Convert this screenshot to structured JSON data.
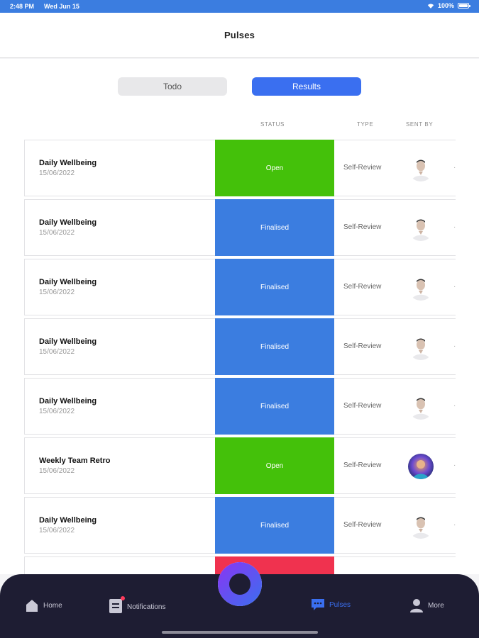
{
  "status_bar": {
    "time": "2:48 PM",
    "date": "Wed Jun 15",
    "battery": "100%"
  },
  "header": {
    "title": "Pulses"
  },
  "segments": {
    "todo": "Todo",
    "results": "Results"
  },
  "columns": {
    "status": "STATUS",
    "type": "TYPE",
    "sent_by": "SENT BY"
  },
  "colors": {
    "open": "#44c10a",
    "finalised": "#3b7de0",
    "partial": "#f0324f",
    "accent": "#3a6ff0"
  },
  "rows": [
    {
      "name": "Daily Wellbeing",
      "date": "15/06/2022",
      "status": "Open",
      "status_kind": "open",
      "type": "Self-Review",
      "avatar": "person-photo"
    },
    {
      "name": "Daily Wellbeing",
      "date": "15/06/2022",
      "status": "Finalised",
      "status_kind": "finalised",
      "type": "Self-Review",
      "avatar": "person-photo"
    },
    {
      "name": "Daily Wellbeing",
      "date": "15/06/2022",
      "status": "Finalised",
      "status_kind": "finalised",
      "type": "Self-Review",
      "avatar": "person-photo"
    },
    {
      "name": "Daily Wellbeing",
      "date": "15/06/2022",
      "status": "Finalised",
      "status_kind": "finalised",
      "type": "Self-Review",
      "avatar": "person-photo"
    },
    {
      "name": "Daily Wellbeing",
      "date": "15/06/2022",
      "status": "Finalised",
      "status_kind": "finalised",
      "type": "Self-Review",
      "avatar": "person-photo"
    },
    {
      "name": "Weekly Team Retro",
      "date": "15/06/2022",
      "status": "Open",
      "status_kind": "open",
      "type": "Self-Review",
      "avatar": "colorful-avatar"
    },
    {
      "name": "Daily Wellbeing",
      "date": "15/06/2022",
      "status": "Finalised",
      "status_kind": "finalised",
      "type": "Self-Review",
      "avatar": "person-photo"
    },
    {
      "name": "",
      "date": "",
      "status": "",
      "status_kind": "partial",
      "type": "",
      "avatar": ""
    }
  ],
  "tabbar": {
    "home": "Home",
    "notifications": "Notifications",
    "pulses": "Pulses",
    "more": "More"
  }
}
